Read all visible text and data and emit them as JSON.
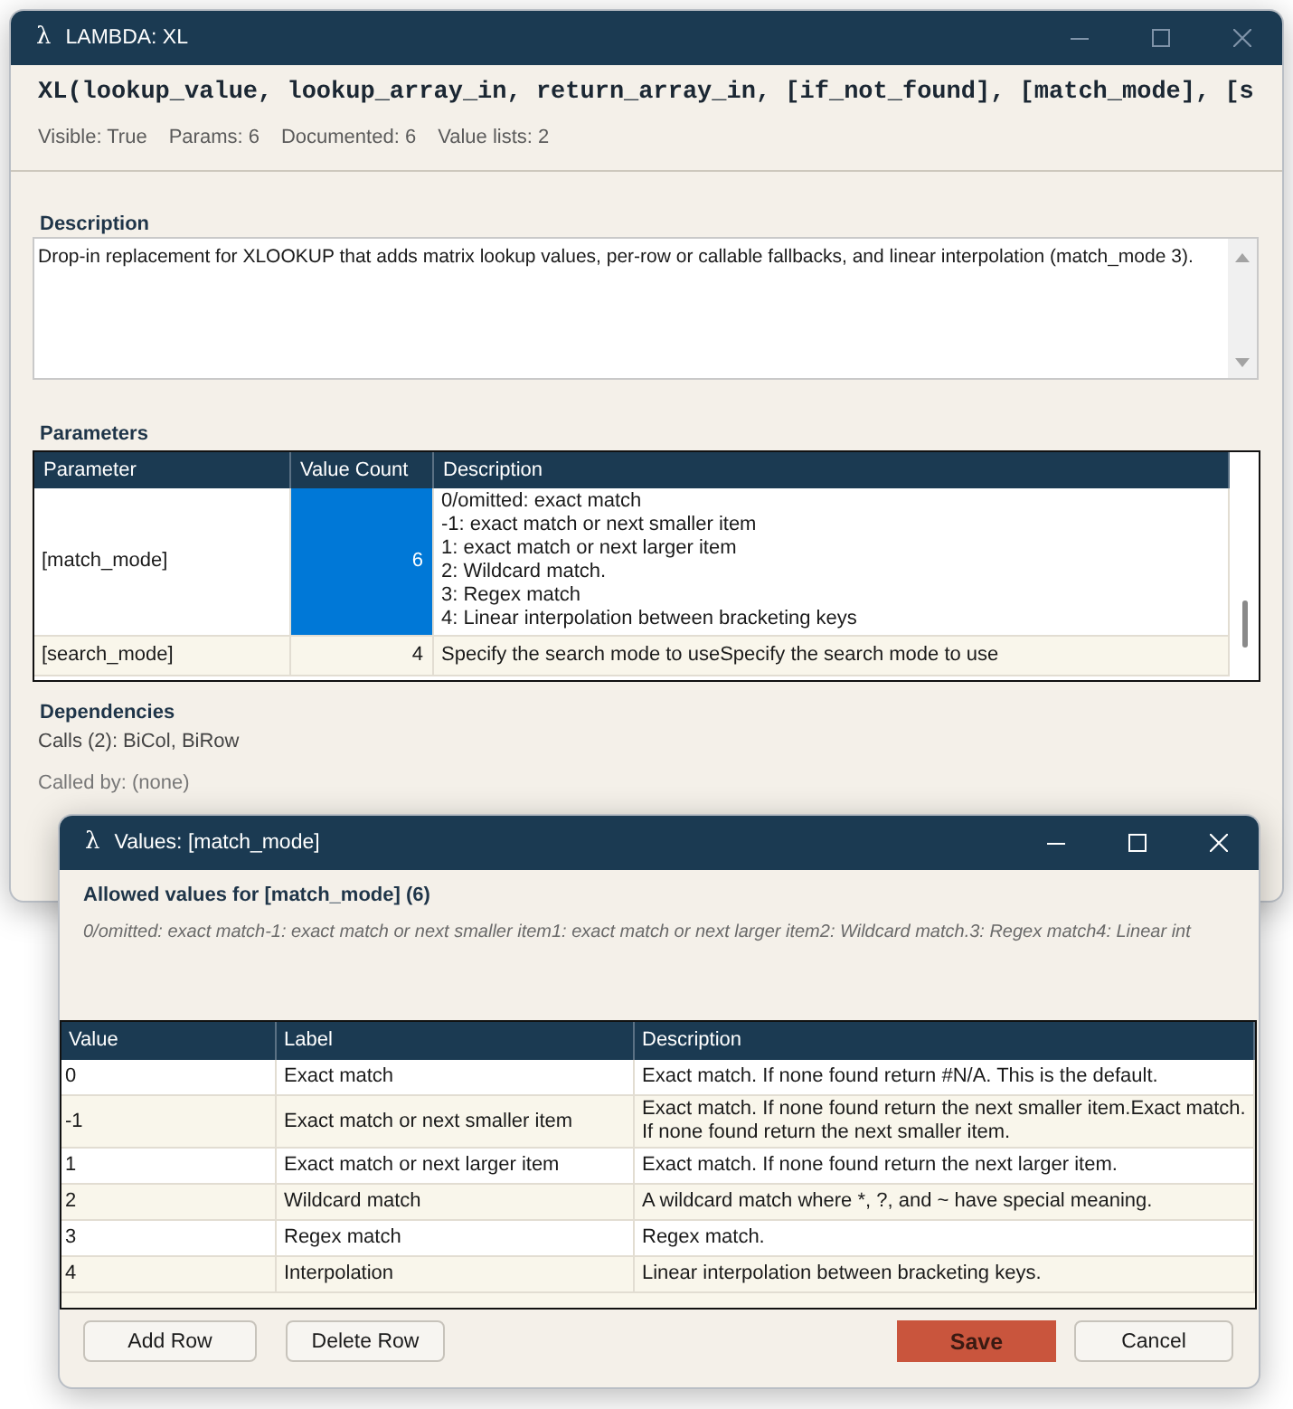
{
  "main_window": {
    "icon": "λ",
    "title": "LAMBDA: XL",
    "active": false,
    "signature": "XL(lookup_value, lookup_array_in, return_array_in, [if_not_found], [match_mode], [s",
    "stats": [
      "Visible: True",
      "Params: 6",
      "Documented: 6",
      "Value lists: 2"
    ],
    "description": {
      "label": "Description",
      "value": "Drop-in replacement for XLOOKUP that adds matrix lookup values, per-row or callable fallbacks, and linear interpolation (match_mode 3)."
    },
    "parameters": {
      "label": "Parameters",
      "columns": [
        "Parameter",
        "Value Count",
        "Description"
      ],
      "rows": [
        {
          "cells": [
            {
              "text": "[match_mode]",
              "selected": false
            },
            {
              "text": "6",
              "selected": true
            },
            {
              "text": "0/omitted: exact match\n-1: exact match or next smaller item\n1: exact match or next larger item\n2: Wildcard match.\n3: Regex match\n4: Linear interpolation between bracketing keys",
              "selected": false
            }
          ]
        },
        {
          "cells": [
            {
              "text": "[search_mode]",
              "selected": false
            },
            {
              "text": "4",
              "selected": false
            },
            {
              "text": "Specify the search mode to useSpecify the search mode to use",
              "selected": false
            }
          ]
        }
      ]
    },
    "dependencies": {
      "label": "Dependencies",
      "calls": "Calls (2): BiCol, BiRow",
      "called_by": "Called by: (none)"
    }
  },
  "values_window": {
    "icon": "λ",
    "title": "Values: [match_mode]",
    "active": true,
    "heading": "Allowed values for [match_mode] (6)",
    "summary": "0/omitted: exact match-1: exact match or next smaller item1: exact match or next larger item2: Wildcard match.3: Regex match4: Linear int",
    "table": {
      "columns": [
        "Value",
        "Label",
        "Description"
      ],
      "rows": [
        [
          "0",
          "Exact match",
          "Exact match. If none found return #N/A. This is the default."
        ],
        [
          "-1",
          "Exact match or next smaller item",
          "Exact match. If none found return the next smaller item.Exact match. If none found return the next smaller item."
        ],
        [
          "1",
          "Exact match or next larger item",
          "Exact match. If none found return the next larger item."
        ],
        [
          "2",
          "Wildcard match",
          "A wildcard match where *, ?, and ~ have special meaning."
        ],
        [
          "3",
          "Regex match",
          "Regex match."
        ],
        [
          "4",
          "Interpolation",
          "Linear interpolation between bracketing keys."
        ]
      ]
    },
    "row_buttons": [
      "Add Row",
      "Delete Row"
    ],
    "dialog_buttons": [
      {
        "label": "Save",
        "kind": "primary"
      },
      {
        "label": "Cancel",
        "kind": "default"
      }
    ]
  }
}
